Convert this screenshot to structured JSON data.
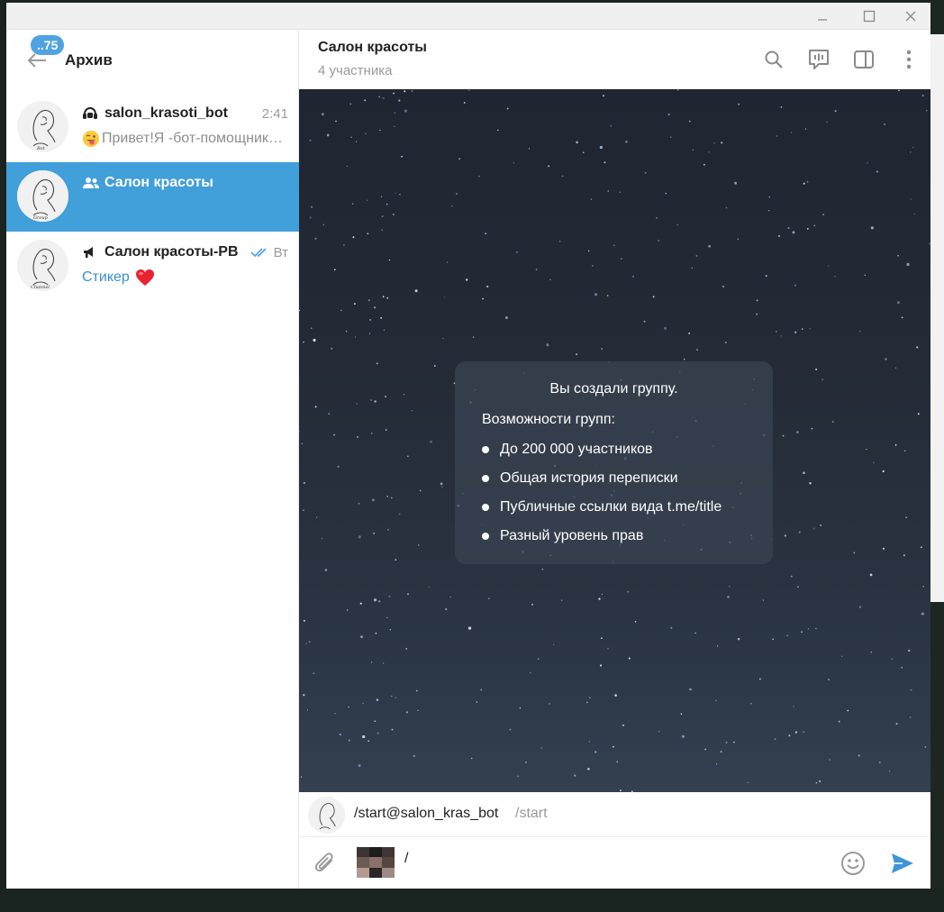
{
  "sidebar": {
    "unread_badge": "..75",
    "title": "Архив",
    "chats": [
      {
        "name": "salon_krasoti_bot",
        "type_icon": "bot-icon",
        "time": "2:41",
        "preview": "Привет!Я -бот-помощник",
        "preview_emoji": "winking-tongue-emoji"
      },
      {
        "name": "Салон красоты",
        "type_icon": "group-icon",
        "time": "",
        "preview": ""
      },
      {
        "name": "Салон красоты-РВ",
        "type_icon": "channel-icon",
        "time": "Вт",
        "read_status": "double-check-icon",
        "preview_prefix": "Стикер",
        "preview_emoji": "red-heart-emoji"
      }
    ]
  },
  "chat": {
    "title": "Салон красоты",
    "subtitle": "4 участника",
    "service_message": {
      "title": "Вы создали группу.",
      "subtitle": "Возможности групп:",
      "features": [
        "До 200 000 участников",
        "Общая история переписки",
        "Публичные ссылки вида t.me/title",
        "Разный уровень прав"
      ]
    },
    "bot_command_suggestion": {
      "command": "/start@salon_kras_bot",
      "description": "/start"
    },
    "compose": {
      "text": "/"
    }
  },
  "colors": {
    "accent": "#419fd9",
    "badge": "#4fa3e0",
    "link": "#3e8fd1",
    "heart": "#e8232f"
  }
}
